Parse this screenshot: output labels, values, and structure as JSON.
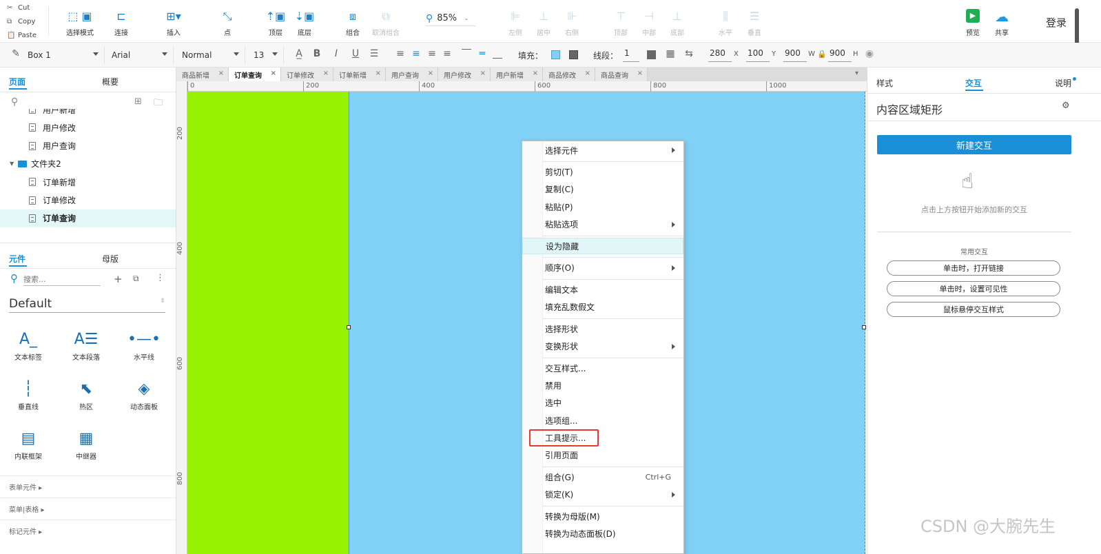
{
  "clipboard": {
    "cut": "Cut",
    "copy": "Copy",
    "paste": "Paste"
  },
  "toolbar": {
    "select_mode": "选择模式",
    "connect": "连接",
    "insert": "插入",
    "point": "点",
    "top_layer": "顶层",
    "bottom_layer": "底层",
    "group": "组合",
    "ungroup": "取消组合",
    "zoom": "85%",
    "align_left": "左侧",
    "align_center": "居中",
    "align_right": "右侧",
    "align_top": "顶部",
    "align_middle": "中部",
    "align_bottom": "底部",
    "dist_horizontal": "水平",
    "dist_vertical": "垂直",
    "preview": "预览",
    "share": "共享",
    "login": "登录"
  },
  "format_bar": {
    "widget_name": "Box 1",
    "font_family": "Arial",
    "font_style": "Normal",
    "font_size": "13",
    "fill_label": "填充：",
    "line_label": "线段：",
    "line_width": "1",
    "x": "280",
    "x_unit": "X",
    "y": "100",
    "y_unit": "Y",
    "w": "900",
    "w_unit": "W",
    "h": "900",
    "h_unit": "H"
  },
  "left_panel": {
    "tab_pages": "页面",
    "tab_outline": "概要",
    "tree": [
      {
        "label": "用户新增",
        "type": "page"
      },
      {
        "label": "用户修改",
        "type": "page"
      },
      {
        "label": "用户查询",
        "type": "page"
      },
      {
        "label": "文件夹2",
        "type": "folder"
      },
      {
        "label": "订单新增",
        "type": "page"
      },
      {
        "label": "订单修改",
        "type": "page"
      },
      {
        "label": "订单查询",
        "type": "page",
        "selected": true
      }
    ],
    "tab_widgets": "元件",
    "tab_masters": "母版",
    "search_placeholder": "搜索...",
    "library": "Default",
    "widgets": [
      "文本标签",
      "文本段落",
      "水平线",
      "垂直线",
      "热区",
      "动态面板",
      "内联框架",
      "中继器"
    ],
    "sections": [
      "表单元件 ▸",
      "菜单|表格 ▸",
      "标记元件 ▸"
    ]
  },
  "doc_tabs": [
    "商品新增",
    "订单查询",
    "订单修改",
    "订单新增",
    "用户查询",
    "用户修改",
    "用户新增",
    "商品修改",
    "商品查询"
  ],
  "ruler": {
    "h": [
      "0",
      "200",
      "400",
      "600",
      "800",
      "1000"
    ],
    "v": [
      "200",
      "400",
      "600",
      "800"
    ]
  },
  "context_menu": {
    "items": [
      {
        "label": "选择元件",
        "submenu": true
      },
      {
        "label": "剪切(T)"
      },
      {
        "label": "复制(C)"
      },
      {
        "label": "粘贴(P)"
      },
      {
        "label": "粘贴选项",
        "submenu": true
      },
      {
        "label": "设为隐藏",
        "highlight": true
      },
      {
        "label": "顺序(O)",
        "submenu": true
      },
      {
        "label": "编辑文本"
      },
      {
        "label": "填充乱数假文"
      },
      {
        "label": "选择形状"
      },
      {
        "label": "变换形状",
        "submenu": true
      },
      {
        "label": "交互样式..."
      },
      {
        "label": "禁用"
      },
      {
        "label": "选中"
      },
      {
        "label": "选项组..."
      },
      {
        "label": "工具提示..."
      },
      {
        "label": "引用页面"
      },
      {
        "label": "组合(G)",
        "shortcut": "Ctrl+G"
      },
      {
        "label": "锁定(K)",
        "submenu": true
      },
      {
        "label": "转换为母版(M)"
      },
      {
        "label": "转换为动态面板(D)"
      }
    ]
  },
  "right_panel": {
    "tab_style": "样式",
    "tab_interaction": "交互",
    "tab_notes": "说明",
    "element_name": "内容区域矩形",
    "new_interaction": "新建交互",
    "hint": "点击上方按钮开始添加新的交互",
    "common_title": "常用交互",
    "common": [
      "单击时，打开链接",
      "单击时，设置可见性",
      "鼠标悬停交互样式"
    ]
  },
  "watermark": "CSDN @大腕先生",
  "colors": {
    "green_panel": "#96f200",
    "blue_panel": "#81d0f5",
    "accent": "#1a8fd8",
    "highlight_box": "#e53935"
  }
}
